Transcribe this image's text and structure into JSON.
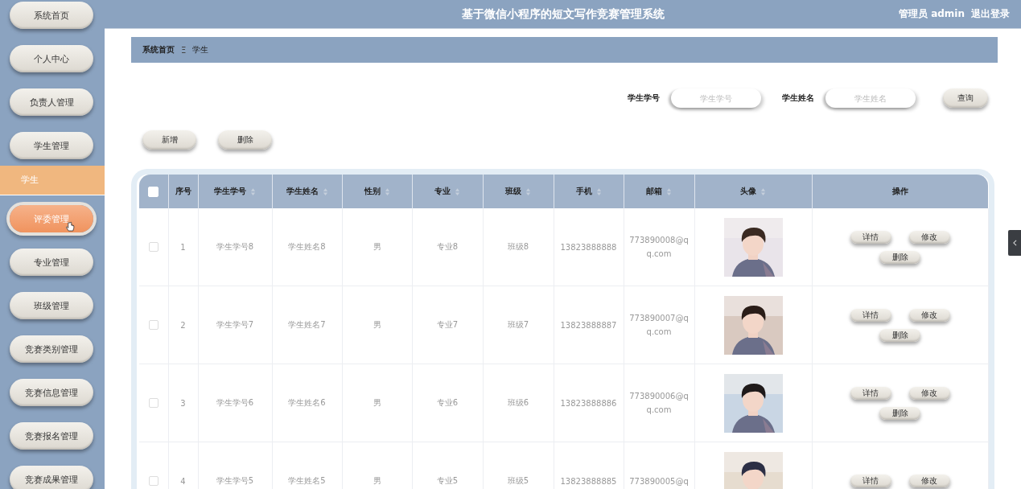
{
  "sidebar": {
    "items": [
      {
        "label": "系统首页",
        "hovered": false
      },
      {
        "label": "个人中心",
        "hovered": false
      },
      {
        "label": "负责人管理",
        "hovered": false
      },
      {
        "label": "学生管理",
        "hovered": false,
        "children": [
          {
            "label": "学生",
            "selected": true
          }
        ]
      },
      {
        "label": "评委管理",
        "hovered": true
      },
      {
        "label": "专业管理",
        "hovered": false
      },
      {
        "label": "班级管理",
        "hovered": false
      },
      {
        "label": "竞赛类别管理",
        "hovered": false
      },
      {
        "label": "竞赛信息管理",
        "hovered": false
      },
      {
        "label": "竞赛报名管理",
        "hovered": false
      },
      {
        "label": "竞赛成果管理",
        "hovered": false
      }
    ]
  },
  "header": {
    "title": "基于微信小程序的短文写作竞赛管理系统",
    "user": "管理员 admin",
    "logout": "退出登录"
  },
  "breadcrumb": {
    "home": "系统首页",
    "separator": "Ξ",
    "current": "学生"
  },
  "search": {
    "fields": [
      {
        "label": "学生学号",
        "placeholder": "学生学号"
      },
      {
        "label": "学生姓名",
        "placeholder": "学生姓名"
      }
    ],
    "button": "查询"
  },
  "toolbar": [
    "新增",
    "删除"
  ],
  "table": {
    "select_all_checked": false,
    "columns": [
      {
        "label": "序号",
        "sortable": false
      },
      {
        "label": "学生学号",
        "sortable": true
      },
      {
        "label": "学生姓名",
        "sortable": true
      },
      {
        "label": "性别",
        "sortable": true
      },
      {
        "label": "专业",
        "sortable": true
      },
      {
        "label": "班级",
        "sortable": true
      },
      {
        "label": "手机",
        "sortable": true
      },
      {
        "label": "邮箱",
        "sortable": true
      },
      {
        "label": "头像",
        "sortable": true
      },
      {
        "label": "操作",
        "sortable": false
      }
    ],
    "rows": [
      {
        "checked": false,
        "cells": [
          "1",
          "学生学号8",
          "学生姓名8",
          "男",
          "专业8",
          "班级8",
          "13823888888",
          "773890008@qq.com"
        ],
        "avatar": {
          "kind": "picture"
        },
        "actions": [
          "详情",
          "修改",
          "删除"
        ]
      },
      {
        "checked": false,
        "cells": [
          "2",
          "学生学号7",
          "学生姓名7",
          "男",
          "专业7",
          "班级7",
          "13823888887",
          "773890007@qq.com"
        ],
        "avatar": {
          "kind": "picture"
        },
        "actions": [
          "详情",
          "修改",
          "删除"
        ]
      },
      {
        "checked": false,
        "cells": [
          "3",
          "学生学号6",
          "学生姓名6",
          "男",
          "专业6",
          "班级6",
          "13823888886",
          "773890006@qq.com"
        ],
        "avatar": {
          "kind": "picture"
        },
        "actions": [
          "详情",
          "修改",
          "删除"
        ]
      },
      {
        "checked": false,
        "cells": [
          "4",
          "学生学号5",
          "学生姓名5",
          "男",
          "专业5",
          "班级5",
          "13823888885",
          "773890005@q"
        ],
        "avatar": {
          "kind": "picture"
        },
        "actions": [
          "详情",
          "修改"
        ]
      }
    ]
  }
}
